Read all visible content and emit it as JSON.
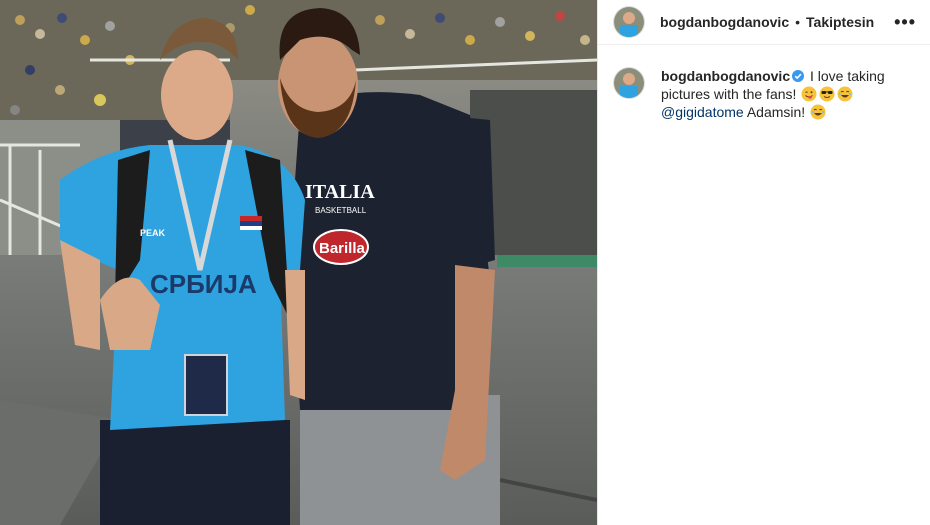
{
  "post": {
    "username": "bogdanbogdanovic",
    "separator": "•",
    "follow_label": "Takiptesin",
    "more_label": "•••",
    "icon_more": "more-options-icon",
    "icon_verified": "verified-badge-icon"
  },
  "photo": {
    "jersey_country": "СРБИЈА",
    "jersey_brand": "PEAK",
    "shirt_text": "ITALIA",
    "shirt_subtext": "BASKETBALL",
    "shirt_logo": "Barilla"
  },
  "caption": {
    "username": "bogdanbogdanovic",
    "text_1": " I love taking pictures with the fans! ",
    "mention": "@gigidatome",
    "text_2": " Adamsin! ",
    "emojis": [
      "winking-tongue-emoji",
      "sunglasses-emoji",
      "laughing-emoji",
      "laughing-emoji"
    ]
  },
  "colors": {
    "text": "#262626",
    "verified": "#3897f0",
    "mention": "#003569",
    "jersey": "#2ea3e0",
    "shirt": "#1d2230"
  }
}
